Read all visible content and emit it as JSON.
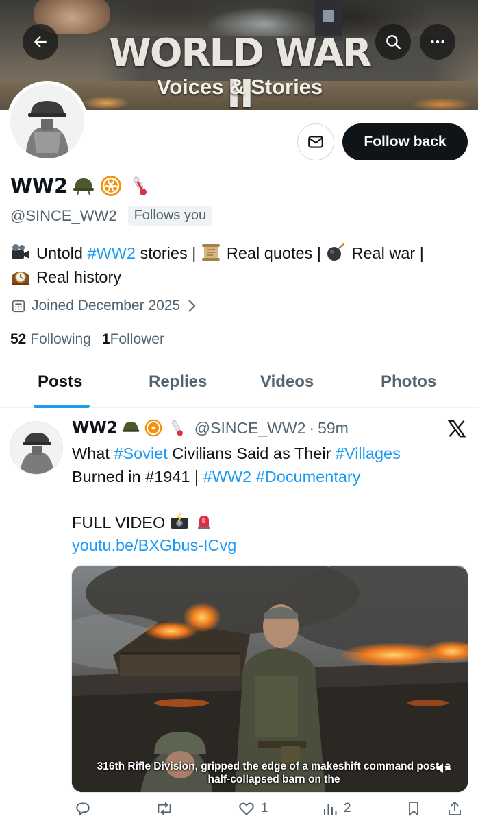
{
  "banner": {
    "title": "WORLD WAR II",
    "subtitle": "Voices & Stories"
  },
  "header_buttons": {
    "back_icon": "arrow-left-icon",
    "search_icon": "search-icon",
    "more_icon": "more-horizontal-icon"
  },
  "profile": {
    "display_name": "WW2",
    "badges": [
      "military-helmet-emoji",
      "biohazard-emoji",
      "thermometer-emoji"
    ],
    "handle": "@SINCE_WW2",
    "follows_you": "Follows you",
    "bio": {
      "part1": "Untold ",
      "hashtag": "#WW2",
      "part2": " stories | ",
      "part3": "Real quotes | ",
      "part4": "Real war | ",
      "part5": "Real history"
    },
    "joined": "Joined December 2025",
    "following_count": "52",
    "following_label": "Following",
    "followers_count": "1",
    "followers_label": "Follower"
  },
  "actions": {
    "message_icon": "envelope-icon",
    "follow_back": "Follow back"
  },
  "tabs": [
    {
      "label": "Posts",
      "active": true
    },
    {
      "label": "Replies",
      "active": false
    },
    {
      "label": "Videos",
      "active": false
    },
    {
      "label": "Photos",
      "active": false
    }
  ],
  "post": {
    "author": "WW2",
    "handle": "@SINCE_WW2",
    "separator": "·",
    "time": "59m",
    "line1_a": "What ",
    "line1_h1": "#Soviet",
    "line1_b": " Civilians Said as Their ",
    "line1_h2": "#Villages",
    "line2_a": "Burned in #1941 | ",
    "line2_h1": "#WW2",
    "line2_sp": " ",
    "line2_h2": "#Documentary",
    "line3": "FULL VIDEO",
    "link": "youtu.be/BXGbus-ICvg",
    "caption": "316th Rifle Division, gripped the edge of a makeshift command post, a half-collapsed barn on the",
    "counts": {
      "replies": "",
      "reposts": "",
      "likes": "1",
      "views": "2"
    }
  },
  "colors": {
    "accent": "#1d9bf0",
    "text": "#0f1419",
    "muted": "#536471"
  }
}
